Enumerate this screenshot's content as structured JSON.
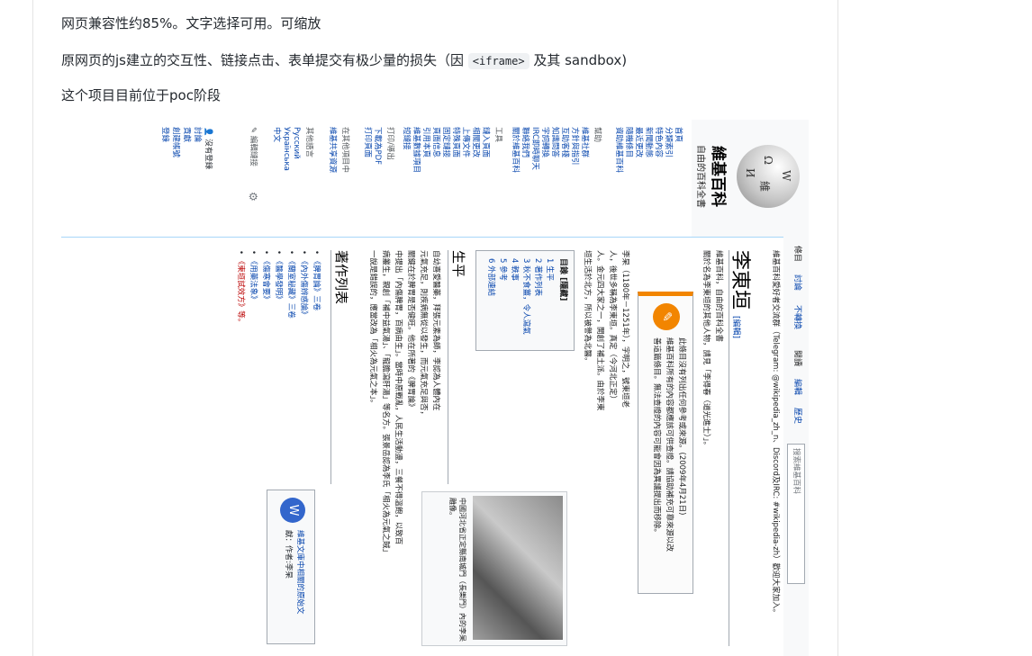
{
  "intro": {
    "line1": "网页兼容性约85%。文字选择可用。可缩放",
    "line2_before": "原网页的js建立的交互性、链接点击、表单提交有极少量的损失（因 ",
    "line2_code": "<iframe>",
    "line2_after": " 及其 sandbox)",
    "line3": "这个项目目前位于poc阶段"
  },
  "wiki": {
    "logo": {
      "globe_glyphs": [
        "W",
        "Ω",
        "維",
        "И"
      ],
      "title": "維基百科",
      "subtitle": "自由的百科全書"
    },
    "nav_main": [
      "首頁",
      "分類索引",
      "特色內容",
      "新聞動態",
      "最近更改",
      "隨機條目",
      "資助維基百科"
    ],
    "nav_help": {
      "heading": "幫助",
      "items": [
        "維基社群",
        "方針與指引",
        "互助客棧",
        "知識問答",
        "字詞轉換",
        "IRC即時聊天",
        "聯絡我們",
        "關於維基百科"
      ]
    },
    "nav_tools": {
      "heading": "工具",
      "items": [
        "鏈入頁面",
        "相關更改",
        "上傳文件",
        "特殊頁面",
        "固定鏈接",
        "頁面信息",
        "引用本頁",
        "維基數據項目",
        "短鏈接"
      ]
    },
    "nav_print": {
      "heading": "打印/導出",
      "items": [
        "下載為PDF",
        "打印頁面"
      ]
    },
    "nav_other_projects": {
      "heading": "在其他項目中",
      "items": [
        "維基共享資源"
      ]
    },
    "nav_languages": {
      "heading": "其他語言",
      "items": [
        "Русский",
        "Українська",
        "中文"
      ]
    },
    "edit_links_label": "編輯鏈接",
    "user_tools": [
      "沒有登錄",
      "討論",
      "貢獻",
      "創建帳號",
      "登錄"
    ],
    "tabs": {
      "article": "條目",
      "talk": "討論",
      "variant": "不轉換",
      "read": "閱讀",
      "edit": "編輯",
      "history": "歷史",
      "search_placeholder": "搜索維基百科"
    },
    "site_notice": "維基百科愛好者交流群（Telegram: @wikipedia_zh_n、Discord及IRC: #wikipedia-zh）歡迎大家加入。",
    "title": "李東垣",
    "edit_label": "[編輯]",
    "from_line": "維基百科，自由的百科全書",
    "hatnote": "關於名為李東垣的其他人物，請見「李得春（道光進士）」。",
    "ambox": {
      "line1": "此條目沒有列出任何參考或來源。(2009年4月21日)",
      "line2": "維基百科所有的內容都應該可供查證。請協助補充可靠來源以改",
      "line3": "善這篇條目。無法查證的內容可能會因為異議提出而移除。"
    },
    "lead": [
      "李杲（1180年－1251年），字明之，號東垣老",
      "人，後世多稱為李東垣。真定（今河北正定）",
      "人。金元四大家之一，開創了補土派。由於李東",
      "垣生活於北方，所以被譽為北醫。"
    ],
    "toc": {
      "title": "目錄 [隱藏]",
      "items": [
        "1 生平",
        "2 著作列表",
        "3 秋不食薑，令人瀉氣",
        "4 軼事",
        "5 參考",
        "6 外部連結"
      ]
    },
    "section_bio": {
      "heading": "生平",
      "paragraph": [
        "自幼喜愛醫藥，拜張元素為師，李認為人體內在",
        "元氣充足，則疾病無從以發生，而元氣充足與否，",
        "關鍵在於脾胃是否健旺。他在所著的《脾胃論》",
        "中提出「內傷脾胃，百病由生」。當時中原戰亂，人民生活動盪，三餐不得溫飽，以致百",
        "病叢生，親創「補中益氣湯」、「龍膽瀉肝湯」等名方。張景岳認為李氏「相火為元氣之賊」",
        "一說是錯誤的，應當改為「相火為元氣之本」。"
      ]
    },
    "image_caption": "中國河北省正定縣南城門（長樂門）內的李杲雕像。",
    "section_works": {
      "heading": "著作列表",
      "items": [
        "《脾胃論》三卷",
        "《內外傷辨惑論》",
        "《蘭室秘藏》三卷",
        "《醫學發明》",
        "《傷寒會要》",
        "《用藥法象》",
        "《東垣試效方》等。"
      ]
    },
    "wikisource": {
      "line1": "維基文庫中相關的原始文",
      "line2": "獻：作者:李杲"
    }
  }
}
